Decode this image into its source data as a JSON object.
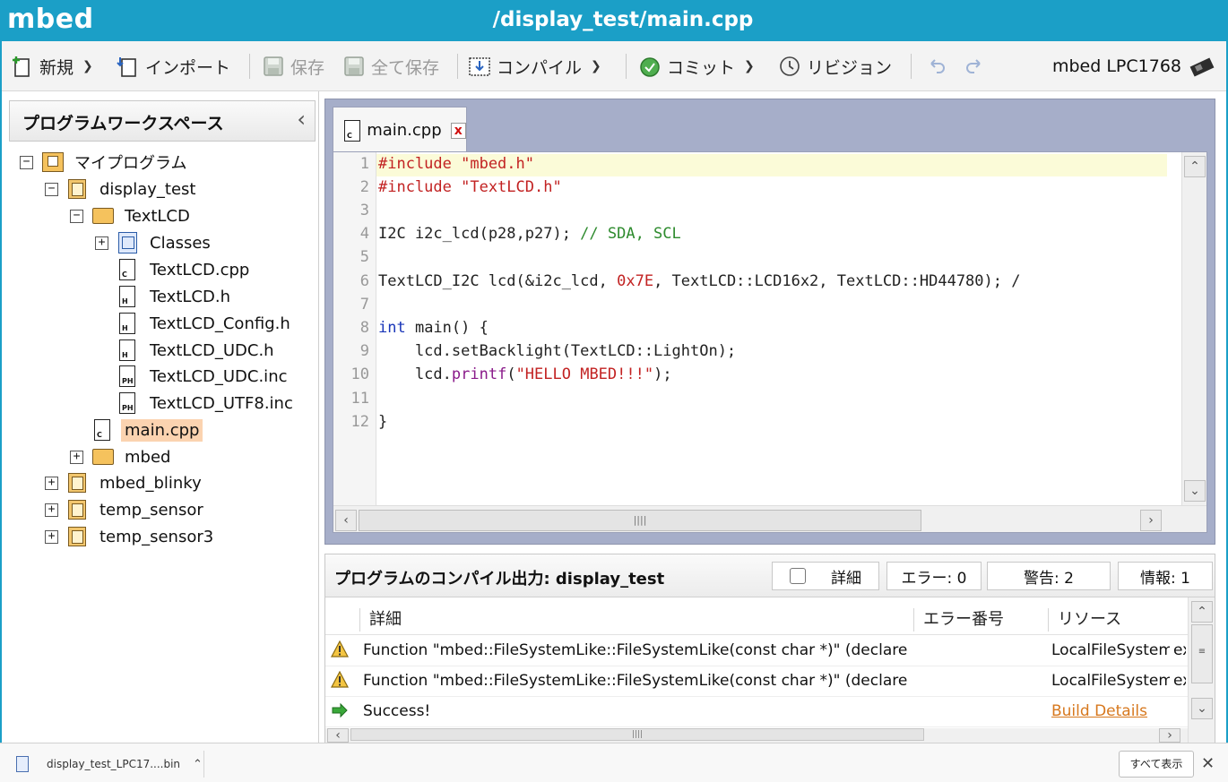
{
  "header": {
    "logo": "mbed",
    "title": "/display_test/main.cpp"
  },
  "toolbar": {
    "new_label": "新規",
    "import_label": "インポート",
    "save_label": "保存",
    "save_all_label": "全て保存",
    "compile_label": "コンパイル",
    "commit_label": "コミット",
    "revision_label": "リビジョン",
    "device_label": "mbed LPC1768"
  },
  "workspace": {
    "title": "プログラムワークスペース",
    "items": [
      {
        "label": "マイプログラム"
      },
      {
        "label": "display_test"
      },
      {
        "label": "TextLCD"
      },
      {
        "label": "Classes"
      },
      {
        "label": "TextLCD.cpp"
      },
      {
        "label": "TextLCD.h"
      },
      {
        "label": "TextLCD_Config.h"
      },
      {
        "label": "TextLCD_UDC.h"
      },
      {
        "label": "TextLCD_UDC.inc"
      },
      {
        "label": "TextLCD_UTF8.inc"
      },
      {
        "label": "main.cpp"
      },
      {
        "label": "mbed"
      },
      {
        "label": "mbed_blinky"
      },
      {
        "label": "temp_sensor"
      },
      {
        "label": "temp_sensor3"
      }
    ]
  },
  "editor": {
    "tab_label": "main.cpp",
    "tab_close": "x",
    "line_numbers": [
      "1",
      "2",
      "3",
      "4",
      "5",
      "6",
      "7",
      "8",
      "9",
      "10",
      "11",
      "12"
    ],
    "code": {
      "l1": "#include \"mbed.h\"",
      "l2": "#include \"TextLCD.h\"",
      "l4a": "I2C i2c_lcd(p28,p27); ",
      "l4b": "// SDA, SCL",
      "l6a": "TextLCD_I2C lcd(&i2c_lcd, ",
      "l6b": "0x7E",
      "l6c": ", TextLCD::LCD16x2, TextLCD::HD44780); /",
      "l8a": "int",
      "l8b": " main() {",
      "l9": "    lcd.setBacklight(TextLCD::LightOn);",
      "l10a": "    lcd.",
      "l10b": "printf",
      "l10c": "(",
      "l10d": "\"HELLO MBED!!!\"",
      "l10e": ");",
      "l12": "}"
    }
  },
  "output": {
    "title": "プログラムのコンパイル出力: display_test",
    "details_toggle": "詳細",
    "errors": "エラー: 0",
    "warnings": "警告: 2",
    "info": "情報: 1",
    "columns": {
      "detail": "詳細",
      "error_no": "エラー番号",
      "resource": "リソース"
    },
    "rows": [
      {
        "detail": "Function \"mbed::FileSystemLike::FileSystemLike(const char *)\" (declare",
        "resource": "LocalFileSystem",
        "extra": "ex"
      },
      {
        "detail": "Function \"mbed::FileSystemLike::FileSystemLike(const char *)\" (declare",
        "resource": "LocalFileSystem",
        "extra": "ex"
      },
      {
        "detail": "Success!",
        "resource": "Build Details",
        "extra": ""
      }
    ]
  },
  "download_bar": {
    "file_name": "display_test_LPC17....bin",
    "show_all": "すべて表示"
  },
  "colors": {
    "header": "#1b9fc7",
    "selection": "#fbd3b0",
    "editor_frame": "#a6aec9",
    "link": "#d7781e"
  }
}
